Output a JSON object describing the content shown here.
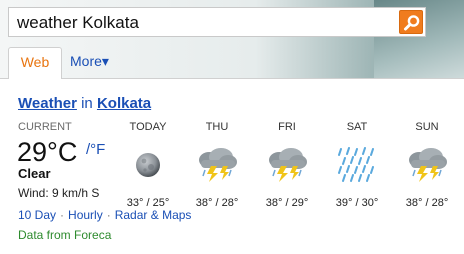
{
  "search": {
    "query": "weather Kolkata"
  },
  "tabs": {
    "web": "Web",
    "more": "More▾"
  },
  "answer": {
    "title_keyword": "Weather",
    "title_in": "in",
    "title_city": "Kolkata",
    "current_label": "CURRENT",
    "temperature": "29°C",
    "alt_unit": "/°F",
    "condition": "Clear",
    "wind": "Wind: 9 km/h S",
    "days": [
      {
        "name": "TODAY",
        "icon": "moon-icon",
        "range": "33° / 25°"
      },
      {
        "name": "THU",
        "icon": "thunderstorm-icon",
        "range": "38° / 28°"
      },
      {
        "name": "FRI",
        "icon": "thunderstorm-icon",
        "range": "38° / 29°"
      },
      {
        "name": "SAT",
        "icon": "rain-icon",
        "range": "39° / 30°"
      },
      {
        "name": "SUN",
        "icon": "thunderstorm-icon",
        "range": "38° / 28°"
      }
    ],
    "links": [
      "10 Day",
      "Hourly",
      "Radar & Maps"
    ],
    "link_separator": "·",
    "source": "Data from Foreca"
  },
  "colors": {
    "link": "#1a4fb5",
    "active_tab": "#e8740f",
    "search_button": "#f07c1e",
    "source": "#2e8b2e"
  }
}
